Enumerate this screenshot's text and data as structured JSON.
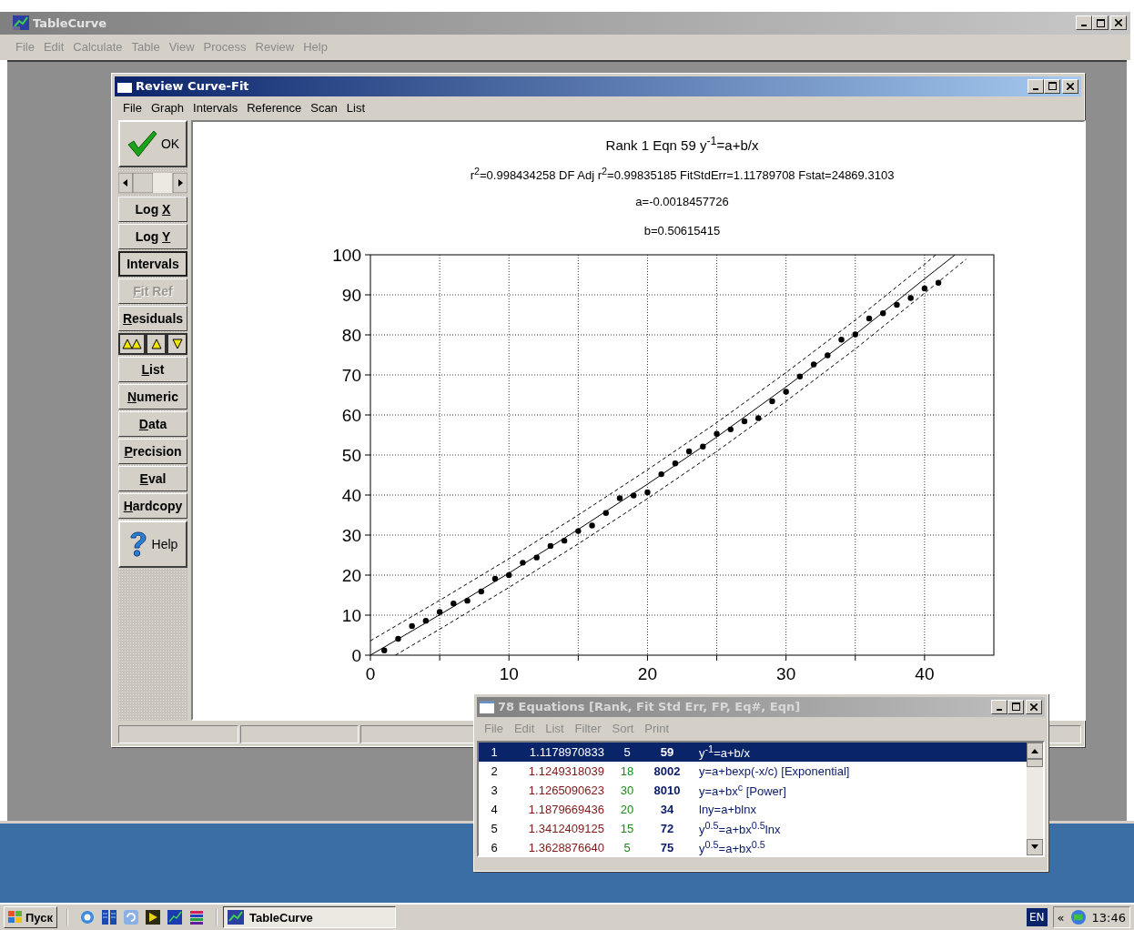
{
  "app": {
    "title": "TableCurve",
    "menu": [
      "File",
      "Edit",
      "Calculate",
      "Table",
      "View",
      "Process",
      "Review",
      "Help"
    ]
  },
  "review_window": {
    "title": "Review Curve-Fit",
    "menu": [
      "File",
      "Graph",
      "Intervals",
      "Reference",
      "Scan",
      "List"
    ],
    "left_buttons": [
      {
        "kind": "confirm",
        "label": "OK"
      },
      {
        "kind": "scroll"
      },
      {
        "kind": "text",
        "before": "Log ",
        "key": "X"
      },
      {
        "kind": "text",
        "before": "Log ",
        "key": "Y"
      },
      {
        "kind": "text",
        "label": "Intervals",
        "pressed": true
      },
      {
        "kind": "text",
        "key": "F",
        "after": "it Ref",
        "disabled": true
      },
      {
        "kind": "text",
        "key": "R",
        "after": "esiduals"
      },
      {
        "kind": "arrows"
      },
      {
        "kind": "text",
        "key": "L",
        "after": "ist"
      },
      {
        "kind": "text",
        "key": "N",
        "after": "umeric"
      },
      {
        "kind": "text",
        "key": "D",
        "after": "ata"
      },
      {
        "kind": "text",
        "key": "P",
        "after": "recision"
      },
      {
        "kind": "text",
        "key": "E",
        "after": "val"
      },
      {
        "kind": "text",
        "key": "H",
        "after": "ardcopy"
      },
      {
        "kind": "help",
        "label": "Help"
      }
    ],
    "plot": {
      "header": [
        "Rank 1  Eqn 59  y$^{-1}$=a+b/x",
        "r$^{2}$=0.998434258  DF Adj r$^{2}$=0.99835185  FitStdErr=1.11789708  Fstat=24869.3103",
        "a=-0.0018457726",
        "b=0.50615415"
      ],
      "chart_data": {
        "type": "scatter",
        "grid": true,
        "xlim": [
          0,
          45
        ],
        "ylim": [
          0,
          100
        ],
        "xticks": [
          0,
          10,
          20,
          30,
          40
        ],
        "yticks": [
          0,
          10,
          20,
          30,
          40,
          50,
          60,
          70,
          80,
          90,
          100
        ],
        "series": [
          {
            "type": "scatter",
            "color": "#000000",
            "x": [
              1,
              2,
              3,
              4,
              5,
              6,
              7,
              8,
              9,
              10,
              11,
              12,
              13,
              14,
              15,
              16,
              17,
              18,
              19,
              20,
              21,
              22,
              23,
              24,
              25,
              26,
              27,
              28,
              29,
              30,
              31,
              32,
              33,
              34,
              35,
              36,
              37,
              38,
              39,
              40,
              41
            ],
            "values": [
              1.2,
              4.1,
              7.3,
              8.6,
              10.8,
              12.9,
              13.6,
              15.9,
              19.1,
              20.0,
              23.1,
              24.4,
              27.3,
              28.6,
              31.0,
              32.4,
              35.5,
              39.2,
              39.9,
              40.7,
              45.2,
              47.9,
              50.9,
              52.1,
              55.3,
              56.4,
              58.4,
              59.2,
              63.4,
              65.8,
              69.6,
              72.6,
              74.9,
              78.8,
              80.1,
              84.1,
              85.4,
              87.5,
              89.2,
              91.6,
              93.0
            ]
          },
          {
            "type": "line",
            "color": "#000000",
            "x": [
              0,
              5,
              10,
              15,
              20,
              25,
              30,
              35,
              40,
              42.2
            ],
            "values": [
              0,
              10.1,
              20.5,
              31.4,
              42.7,
              54.5,
              67.0,
              80.1,
              94.0,
              100
            ]
          },
          {
            "type": "line",
            "line_style": "dashed",
            "color": "#000000",
            "x": [
              0,
              5,
              10,
              15,
              20,
              25,
              30,
              35,
              40,
              40.8
            ],
            "values": [
              3.6,
              13.7,
              24.1,
              35.0,
              46.3,
              58.1,
              70.6,
              83.7,
              97.6,
              100
            ]
          },
          {
            "type": "line",
            "line_style": "dashed",
            "color": "#000000",
            "x": [
              1.8,
              5,
              10,
              15,
              20,
              25,
              30,
              35,
              40,
              43
            ],
            "values": [
              0,
              6.5,
              16.9,
              27.8,
              39.1,
              50.9,
              63.4,
              76.5,
              90.4,
              98.9
            ]
          }
        ]
      }
    }
  },
  "equations_window": {
    "title": "78 Equations  [Rank, Fit Std Err, FP, Eq#, Eqn]",
    "menu": [
      "File",
      "Edit",
      "List",
      "Filter",
      "Sort",
      "Print"
    ],
    "rows": [
      {
        "rank": "1",
        "fit_std_err": "1.1178970833",
        "fp": "5",
        "eq_no": "59",
        "eqn": "y$^{-1}$=a+b/x",
        "selected": true
      },
      {
        "rank": "2",
        "fit_std_err": "1.1249318039",
        "fp": "18",
        "eq_no": "8002",
        "eqn": "y=a+bexp(-x/c) [Exponential]",
        "selected": false
      },
      {
        "rank": "3",
        "fit_std_err": "1.1265090623",
        "fp": "30",
        "eq_no": "8010",
        "eqn": "y=a+bx$^{c}$ [Power]",
        "selected": false
      },
      {
        "rank": "4",
        "fit_std_err": "1.1879669436",
        "fp": "20",
        "eq_no": "34",
        "eqn": "lny=a+blnx",
        "selected": false
      },
      {
        "rank": "5",
        "fit_std_err": "1.3412409125",
        "fp": "15",
        "eq_no": "72",
        "eqn": "y$^{0.5}$=a+bx$^{0.5}$lnx",
        "selected": false
      },
      {
        "rank": "6",
        "fit_std_err": "1.3628876640",
        "fp": "5",
        "eq_no": "75",
        "eqn": "y$^{0.5}$=a+bx$^{0.5}$",
        "selected": false
      }
    ]
  },
  "taskbar": {
    "start": "Пуск",
    "task": "TableCurve",
    "language": "EN",
    "chevron": "«",
    "clock": "13:46"
  }
}
